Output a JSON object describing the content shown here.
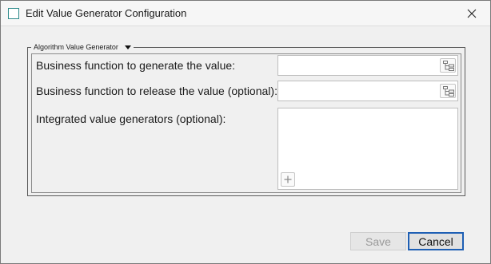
{
  "window": {
    "title": "Edit Value Generator Configuration"
  },
  "group": {
    "legend": "Algorithm Value Generator"
  },
  "fields": {
    "generate_label": "Business function to generate the value:",
    "generate_value": "",
    "release_label": "Business function to release the value (optional):",
    "release_value": "",
    "integrated_label": "Integrated value generators (optional):"
  },
  "buttons": {
    "save": "Save",
    "cancel": "Cancel"
  },
  "icons": {
    "app": "app-window-icon",
    "close": "close-icon",
    "tree": "tree-hierarchy-icon",
    "add": "plus-icon"
  },
  "colors": {
    "focus_border": "#1e5fb4",
    "app_icon": "#2e8b8b",
    "disabled_text": "#9a9a9a"
  },
  "state": {
    "save_enabled": false,
    "focused_button": "cancel"
  }
}
